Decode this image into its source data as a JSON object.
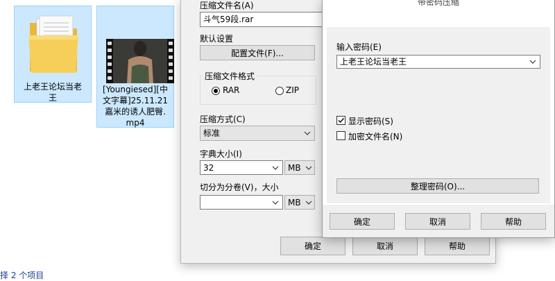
{
  "files": [
    {
      "name": "上老王论坛当老王",
      "lines": [
        "上老王论坛当老",
        "王"
      ],
      "icon": "folder-icon"
    },
    {
      "name": "[Youngiesed][中文字幕]25.11.21嘉米的诱人肥臀.mp4",
      "lines": [
        "[Youngiesed][中",
        "文字幕]25.11.21",
        "嘉米的诱人肥臀.",
        "mp4"
      ],
      "icon": "video-thumbnail"
    }
  ],
  "status_bar": {
    "text": "择 2 个项目"
  },
  "archive_dialog": {
    "archive_name_label": "压缩文件名(A)",
    "archive_name_value": "斗气59段.rar",
    "default_settings_label": "默认设置",
    "profiles_button": "配置文件(F)...",
    "format_group_title": "压缩文件格式",
    "format_rar": "RAR",
    "format_zip": "ZIP",
    "method_label": "压缩方式(C)",
    "method_value": "标准",
    "dict_label": "字典大小(I)",
    "dict_value": "32",
    "dict_unit": "MB",
    "split_label": "切分为分卷(V)，大小",
    "split_value": "",
    "split_unit": "MB",
    "ok_button": "确定",
    "cancel_button": "取消",
    "help_button": "帮助"
  },
  "password_dialog": {
    "title": "带密码压缩",
    "enter_password_label": "输入密码(E)",
    "password_value": "上老王论坛当老王",
    "show_password_label": "显示密码(S)",
    "show_password_checked": true,
    "encrypt_names_label": "加密文件名(N)",
    "encrypt_names_checked": false,
    "organize_button": "整理密码(O)...",
    "ok_button": "确定",
    "cancel_button": "取消",
    "help_button": "帮助"
  },
  "colors": {
    "selection_bg": "#cce8ff",
    "selection_border": "#99d1ff",
    "dialog_bg": "#f0f0f0",
    "status_text": "#1a3b8c"
  }
}
